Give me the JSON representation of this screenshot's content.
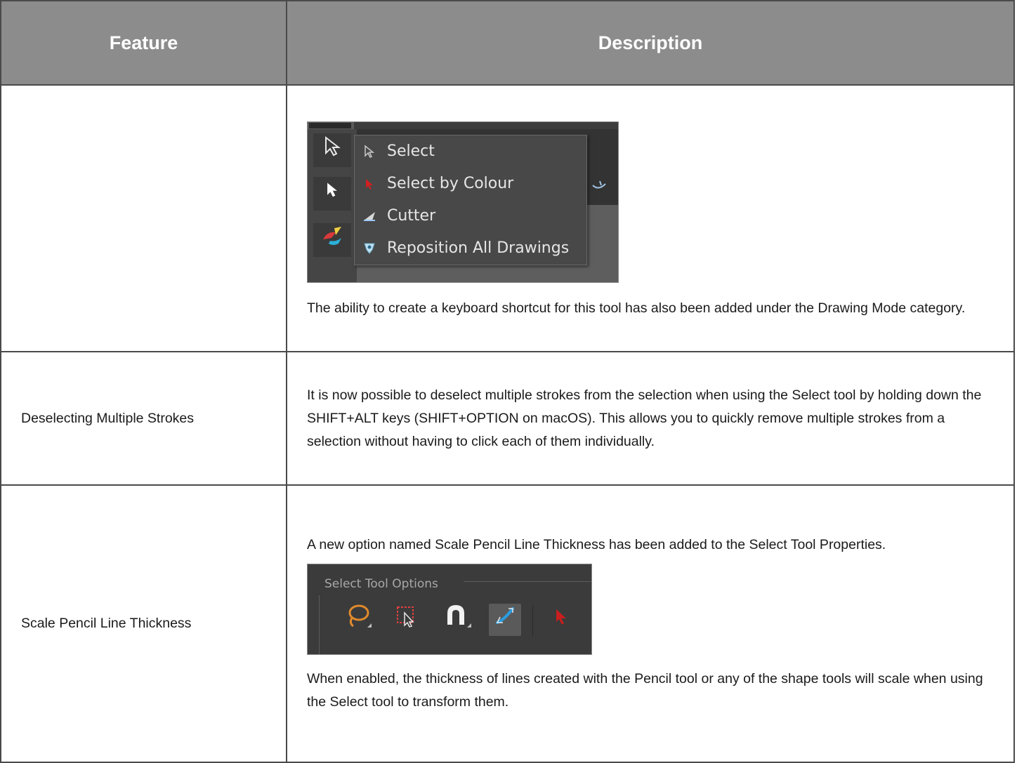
{
  "table": {
    "headers": [
      "Feature",
      "Description"
    ],
    "rows": [
      {
        "feature": "",
        "menu": {
          "items": [
            {
              "label": "Select",
              "icon": "select-arrow-icon"
            },
            {
              "label": "Select by Colour",
              "icon": "select-by-colour-icon"
            },
            {
              "label": "Cutter",
              "icon": "cutter-icon"
            },
            {
              "label": "Reposition All Drawings",
              "icon": "reposition-drawings-icon"
            }
          ]
        },
        "description": [
          "The ability to create a keyboard shortcut for this tool has also been added under the Drawing Mode category."
        ]
      },
      {
        "feature": "Deselecting Multiple Strokes",
        "description": [
          "It is now possible to deselect multiple strokes from the selection when using the Select tool by holding down the SHIFT+ALT keys (SHIFT+OPTION on macOS). This allows you to quickly remove multiple strokes from a selection without having to click each of them individually."
        ]
      },
      {
        "feature": "Scale Pencil Line Thickness",
        "description": [
          "A new option named Scale Pencil Line Thickness has been added to the Select Tool Properties.",
          "When enabled, the thickness of lines created with the Pencil tool or any of the shape tools will scale when using the Select tool to transform them."
        ],
        "tool_options": {
          "title": "Select Tool Options",
          "icons": [
            "lasso-icon",
            "select-box-icon",
            "snap-magnet-icon",
            "scale-line-thickness-icon",
            "select-by-colour-icon"
          ]
        }
      }
    ]
  },
  "colors": {
    "header_bg": "#8c8c8c",
    "border": "#4a4a4a",
    "ui_dark": "#3c3c3c",
    "accent_blue": "#2a9de0",
    "accent_orange": "#e08a2c",
    "accent_red": "#c81e1e"
  }
}
